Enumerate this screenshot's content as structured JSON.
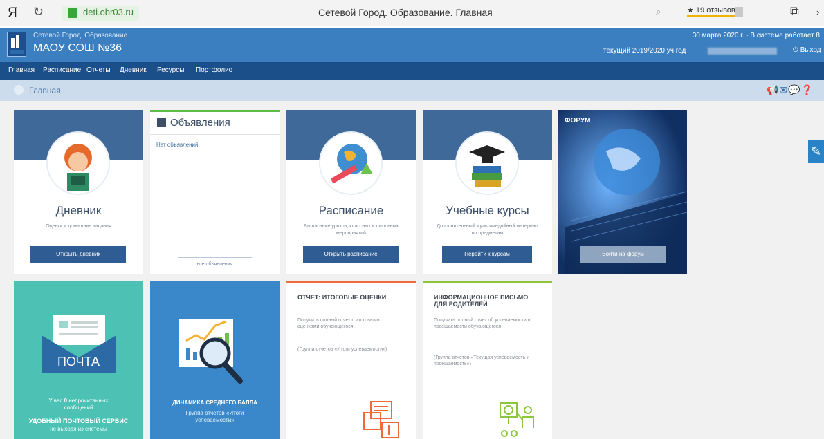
{
  "browser": {
    "logo": "Я",
    "reload_icon": "reload-icon",
    "url": "deti.obr03.ru",
    "title": "Сетевой Город. Образование. Главная",
    "reviews": "★ 19 отзывов"
  },
  "header": {
    "system_name": "Сетевой Город. Образование",
    "school": "МАОУ СОШ №36",
    "date_line": "30 марта 2020 г. - В системе работает 8",
    "year_line": "текущий 2019/2020 уч.год",
    "logout": "⏻ Выход"
  },
  "nav": {
    "items": [
      "Главная",
      "Расписание",
      "Отчеты",
      "Дневник",
      "Ресурсы",
      "Портфолио"
    ]
  },
  "breadcrumb": {
    "current": "Главная"
  },
  "tiles": {
    "diary": {
      "title": "Дневник",
      "desc": "Оценки и домашние задания",
      "button": "Открыть дневник"
    },
    "announcements": {
      "title": "Объявления",
      "none": "Нет объявлений",
      "all": "все объявления"
    },
    "schedule": {
      "title": "Расписание",
      "desc": "Расписание уроков, классных и школьных мероприятий",
      "button": "Открыть расписание"
    },
    "courses": {
      "title": "Учебные курсы",
      "desc": "Дополнительный мультимедийный материал по предметам",
      "button": "Перейти к курсам"
    },
    "forum": {
      "title": "ФОРУМ",
      "button": "Войти на форум"
    },
    "mail": {
      "label": "ПОЧТА",
      "unread_prefix": "У вас",
      "unread_count": "0",
      "unread_suffix": "непрочитанных сообщений",
      "slogan": "УДОБНЫЙ ПОЧТОВЫЙ СЕРВИС",
      "slogan2": "не выходя из системы"
    },
    "dynamics": {
      "title": "ДИНАМИКА СРЕДНЕГО БАЛЛА",
      "sub": "Группа отчетов «Итоги успеваемости»"
    },
    "final_report": {
      "title": "ОТЧЕТ: ИТОГОВЫЕ ОЦЕНКИ",
      "desc": "Получить полный отчет с итоговыми оценками обучающегося",
      "group": "(Группа отчетов «Итоги успеваемости»)"
    },
    "info_letter": {
      "title": "ИНФОРМАЦИОННОЕ ПИСЬМО ДЛЯ РОДИТЕЛЕЙ",
      "desc": "Получить полный отчет об успеваемости и посещаемости обучающегося",
      "group": "(Группа отчетов «Текущая успеваемость и посещаемость»)"
    }
  },
  "colors": {
    "header_blue": "#3c7fc0",
    "nav_blue": "#1b4f8a",
    "tile_band": "#3f6998",
    "mail_teal": "#4cc1b4",
    "report_orange": "#ee6a3a",
    "letter_green": "#8cc63f"
  }
}
